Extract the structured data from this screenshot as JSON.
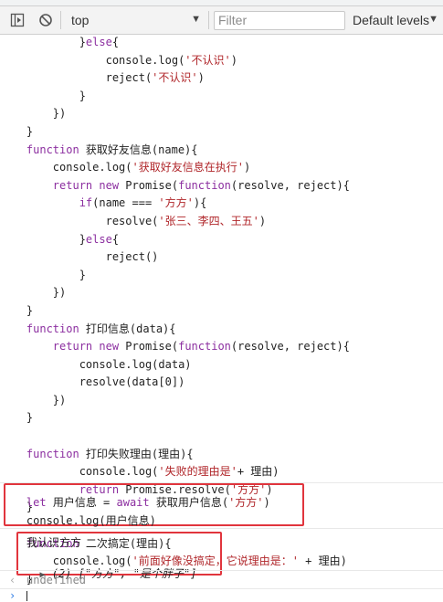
{
  "toolbar": {
    "context_value": "top",
    "filter_placeholder": "Filter",
    "levels_label": "Default levels"
  },
  "code_lines": [
    "        }else{",
    "            console.log('不认识')",
    "            reject('不认识')",
    "        }",
    "    })",
    "}",
    "function 获取好友信息(name){",
    "    console.log('获取好友信息在执行')",
    "    return new Promise(function(resolve, reject){",
    "        if(name === '方方'){",
    "            resolve('张三、李四、王五')",
    "        }else{",
    "            reject()",
    "        }",
    "    })",
    "}",
    "function 打印信息(data){",
    "    return new Promise(function(resolve, reject){",
    "        console.log(data)",
    "        resolve(data[0])",
    "    })",
    "}",
    "",
    "function 打印失败理由(理由){",
    "        console.log('失败的理由是'+ 理由)",
    "        return Promise.resolve('方方')",
    "}",
    "",
    "function 二次搞定(理由){",
    "    console.log('前面好像没搞定，它说理由是：' + 理由)",
    "}"
  ],
  "input_lines": [
    "let 用户信息 = await 获取用户信息('方方')",
    "console.log(用户信息)"
  ],
  "log_output": "我认识方方",
  "array_output": {
    "count": "(2)",
    "items_text": "[\"方方\", \"是个胖子\"]"
  },
  "return_value": "undefined",
  "colors": {
    "keyword": "#8c2fa0",
    "string": "#b0262a",
    "annotation_box": "#e1353d",
    "prompt": "#2d7be5"
  }
}
